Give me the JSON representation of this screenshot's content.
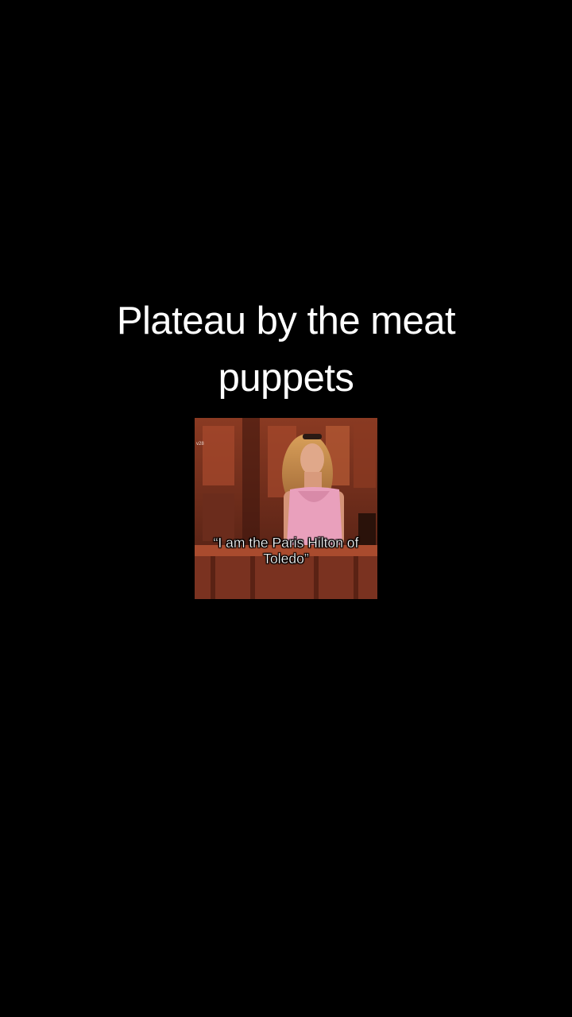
{
  "caption": {
    "text": "Plateau by the meat puppets"
  },
  "clip": {
    "watermark": "v28",
    "quote_line1": "“I am the Paris Hilton of",
    "quote_line2": "Toledo”"
  },
  "colors": {
    "background": "#000000",
    "caption_text": "#ffffff",
    "clip_wood": "#6b2c1c",
    "clip_top": "#a5482c",
    "top_pink": "#e9a0bc"
  }
}
